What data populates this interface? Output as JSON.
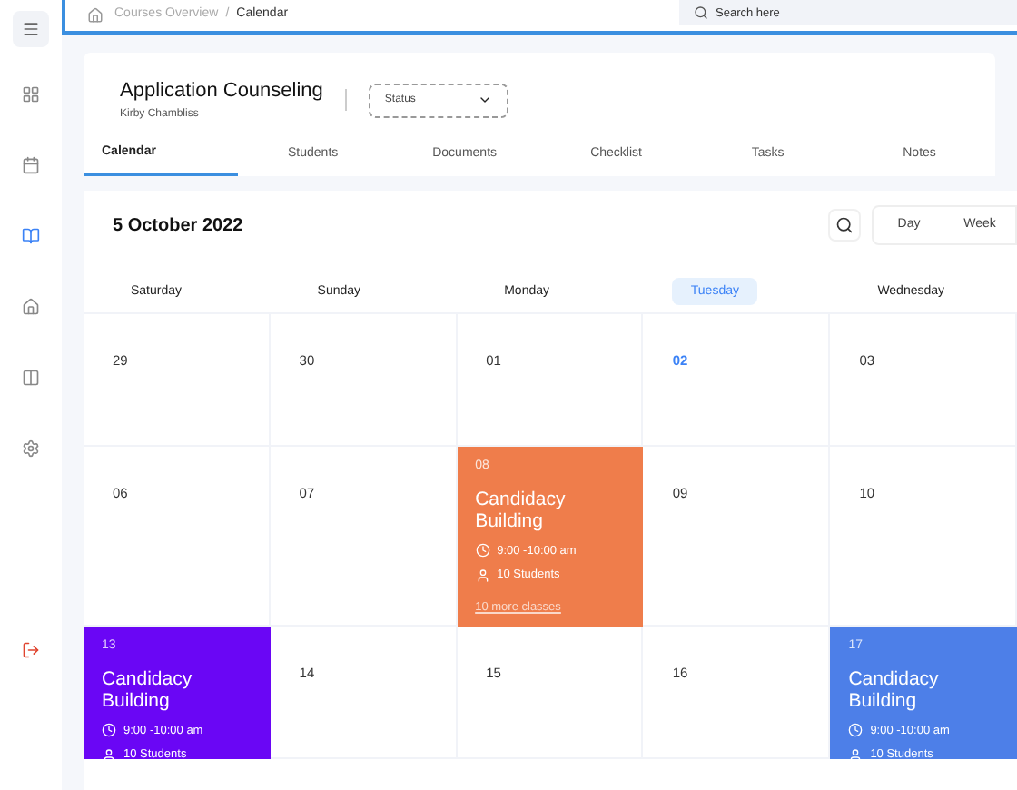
{
  "breadcrumb": {
    "parent": "Courses Overview",
    "separator": "/",
    "current": "Calendar"
  },
  "search": {
    "placeholder": "Search here"
  },
  "sidebar": {
    "items": [
      {
        "selected": false
      },
      {
        "selected": false
      },
      {
        "selected": true
      },
      {
        "selected": false
      },
      {
        "selected": false
      },
      {
        "selected": false
      }
    ]
  },
  "course": {
    "title": "Application Counseling",
    "subtitle": "Kirby Chambliss",
    "status": {
      "placeholder": "Status"
    }
  },
  "tabs": [
    {
      "label": "Calendar",
      "selected": true
    },
    {
      "label": "Students",
      "selected": false
    },
    {
      "label": "Documents",
      "selected": false
    },
    {
      "label": "Checklist",
      "selected": false
    },
    {
      "label": "Tasks",
      "selected": false
    },
    {
      "label": "Notes",
      "selected": false
    }
  ],
  "calendar": {
    "title": "5 October 2022",
    "views": [
      {
        "label": "Day",
        "selected": false
      },
      {
        "label": "Week",
        "selected": false
      }
    ],
    "days": [
      {
        "label": "Saturday",
        "selected": false
      },
      {
        "label": "Sunday",
        "selected": false
      },
      {
        "label": "Monday",
        "selected": false
      },
      {
        "label": "Tuesday",
        "selected": true
      },
      {
        "label": "Wednesday",
        "selected": false
      }
    ],
    "weeks": [
      [
        {
          "date": "29"
        },
        {
          "date": "30"
        },
        {
          "date": "01"
        },
        {
          "date": "02",
          "today": true
        },
        {
          "date": "03"
        }
      ],
      [
        {
          "date": "06"
        },
        {
          "date": "07"
        },
        {
          "date": "08",
          "event": {
            "title": "Candidacy Building",
            "time": "9:00 -10:00 am",
            "students": "10 Students",
            "more": "10 more classes",
            "color": "#ef7d4b"
          }
        },
        {
          "date": "09"
        },
        {
          "date": "10"
        }
      ],
      [
        {
          "date": "13",
          "event": {
            "title": "Candidacy Building",
            "time": "9:00 -10:00 am",
            "students": "10 Students",
            "color": "#6a06f5"
          }
        },
        {
          "date": "14"
        },
        {
          "date": "15"
        },
        {
          "date": "16"
        },
        {
          "date": "17",
          "event": {
            "title": "Candidacy Building",
            "time": "9:00 -10:00 am",
            "students": "10 Students",
            "color": "#4d7fe8"
          }
        }
      ]
    ]
  }
}
